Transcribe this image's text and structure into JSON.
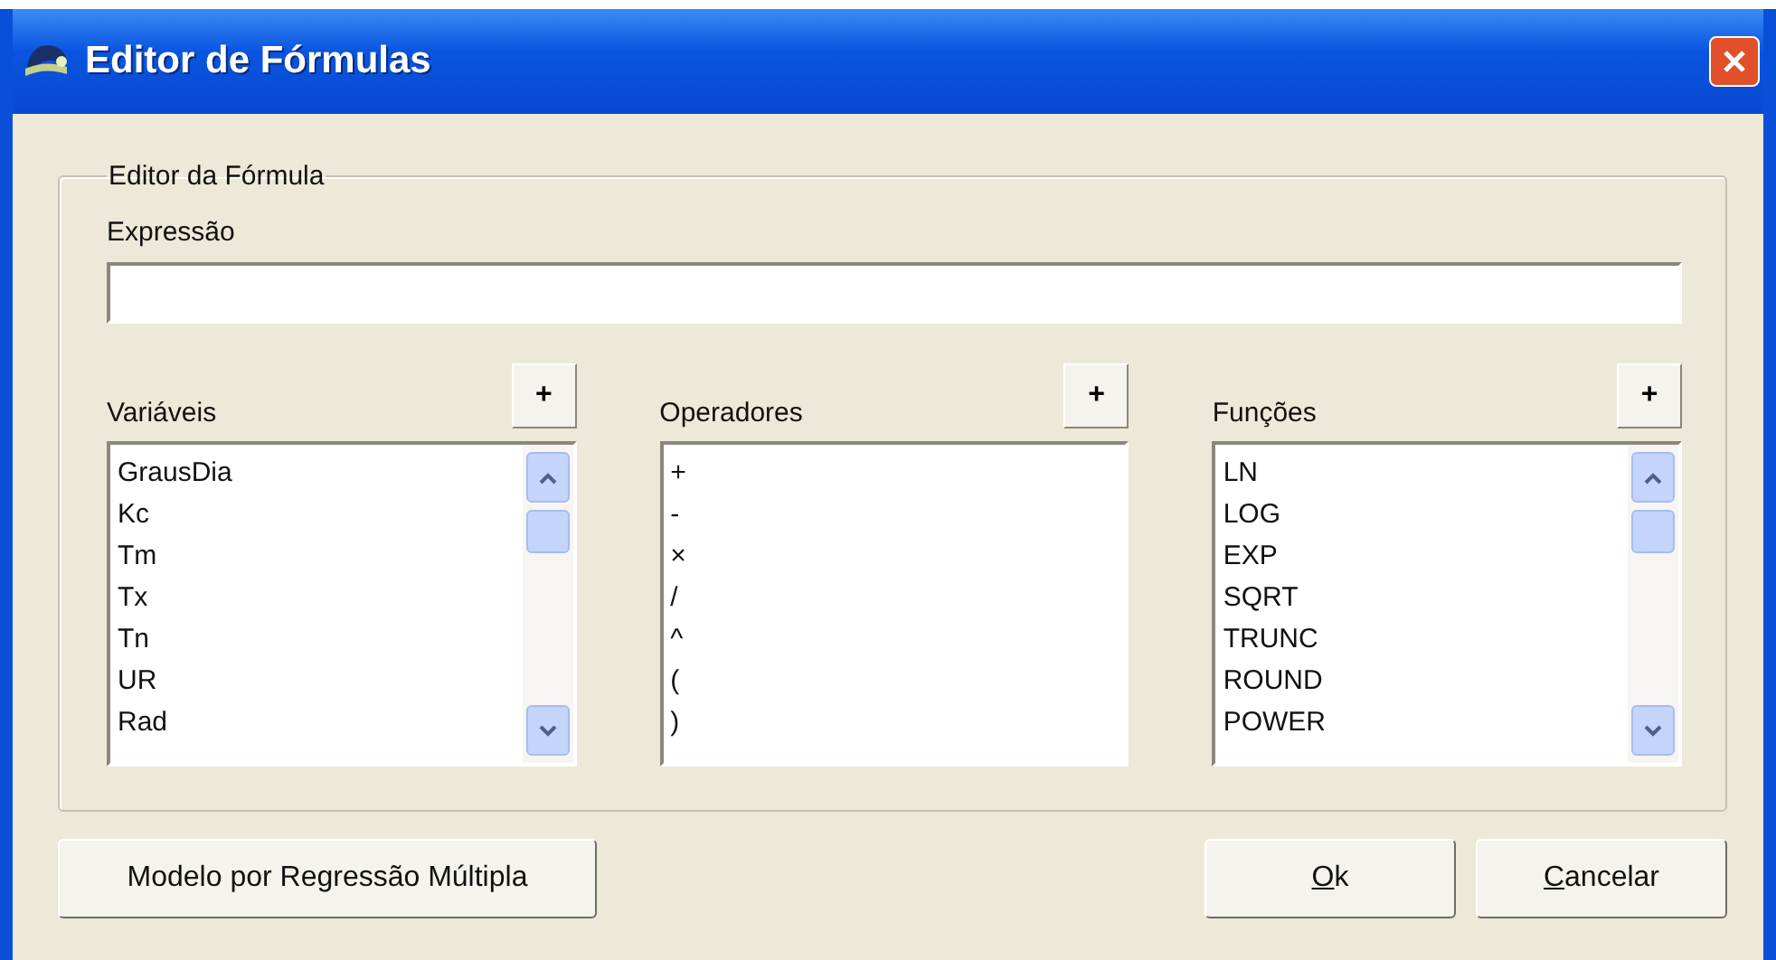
{
  "window": {
    "title": "Editor de Fórmulas"
  },
  "group": {
    "legend": "Editor da Fórmula",
    "expression": {
      "label": "Expressão"
    },
    "lists": [
      {
        "label": "Variáveis",
        "add_button": "+",
        "scrollable": true,
        "items": [
          "GrausDia",
          "Kc",
          "Tm",
          "Tx",
          "Tn",
          "UR",
          "Rad"
        ]
      },
      {
        "label": "Operadores",
        "add_button": "+",
        "scrollable": false,
        "items": [
          "+",
          "-",
          "×",
          "/",
          "^",
          "(",
          ")"
        ]
      },
      {
        "label": "Funções",
        "add_button": "+",
        "scrollable": true,
        "items": [
          "LN",
          "LOG",
          "EXP",
          "SQRT",
          "TRUNC",
          "ROUND",
          "POWER"
        ]
      }
    ]
  },
  "buttons": [
    {
      "label": "Modelo por Regressão Múltipla",
      "mnemonic": false,
      "kind": "left"
    },
    {
      "label": "Ok",
      "mnemonic": true,
      "kind": "right"
    },
    {
      "label": "Cancelar",
      "mnemonic": true,
      "kind": "right"
    }
  ]
}
